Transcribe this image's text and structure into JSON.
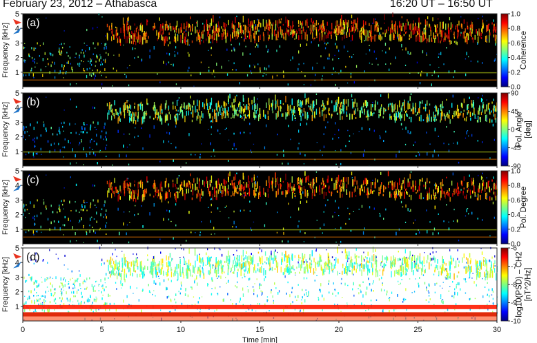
{
  "header": {
    "left": "February 23, 2012 –  Athabasca",
    "right": "16:20 UT – 16:50 UT"
  },
  "chart_data": {
    "type": "heatmap",
    "xlabel": "Time [min]",
    "x_ticks": [
      "0",
      "5",
      "10",
      "15",
      "20",
      "25",
      "30"
    ],
    "xlim": [
      0,
      30
    ],
    "panels": [
      {
        "panel_label": "(a)",
        "ylabel": "Frequency [kHz]",
        "y_ticks": [
          "1",
          "2",
          "3",
          "4",
          "5"
        ],
        "ylim": [
          0,
          5
        ],
        "background": "#000000",
        "colorbar": {
          "label": "Coherence",
          "ticks": [
            "0.0",
            "0.2",
            "0.4",
            "0.6",
            "0.8",
            "1.0"
          ],
          "range": [
            0,
            1
          ]
        }
      },
      {
        "panel_label": "(b)",
        "ylabel": "Frequency [kHz]",
        "y_ticks": [
          "1",
          "2",
          "3",
          "4",
          "5"
        ],
        "ylim": [
          0,
          5
        ],
        "background": "#000000",
        "colorbar": {
          "label": "Pol. Angle\n[deg]",
          "ticks": [
            "-90",
            "-45",
            "0",
            "45",
            "90"
          ],
          "range": [
            -90,
            90
          ]
        }
      },
      {
        "panel_label": "(c)",
        "ylabel": "Frequency [kHz]",
        "y_ticks": [
          "1",
          "2",
          "3",
          "4",
          "5"
        ],
        "ylim": [
          0,
          5
        ],
        "background": "#000000",
        "colorbar": {
          "label": "Pol. Degree",
          "ticks": [
            "0.0",
            "0.2",
            "0.4",
            "0.6",
            "0.8",
            "1.0"
          ],
          "range": [
            0,
            1
          ]
        }
      },
      {
        "panel_label": "(d)",
        "ylabel": "Frequency [kHz]",
        "y_ticks": [
          "1",
          "2",
          "3",
          "4",
          "5"
        ],
        "ylim": [
          0,
          5
        ],
        "background": "#ffffff",
        "colorbar": {
          "label": "log10(PSD) – CH2\n[nT^2/Hz]",
          "ticks": [
            "-10",
            "-9",
            "-8",
            "-7",
            "-6"
          ],
          "range": [
            -10,
            -6
          ]
        }
      }
    ],
    "emission": {
      "band_khz": [
        3.0,
        4.2
      ],
      "onset_min": 5.3,
      "arrow_red_khz": 4.4,
      "arrow_blue_khz": 3.8
    },
    "colors": {
      "red_arrow": "#e8321e",
      "blue_arrow": "#1e73c8"
    }
  }
}
